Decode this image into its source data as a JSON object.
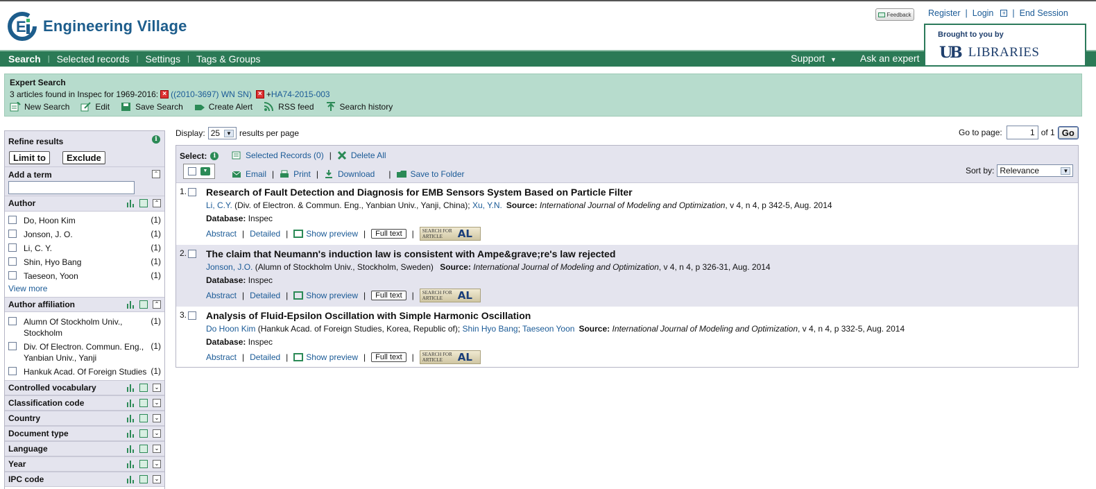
{
  "header": {
    "app_name": "Engineering Village",
    "feedback": "Feedback",
    "top_links": [
      "Register",
      "Login",
      "End Session"
    ],
    "brought_by": "Brought to you by",
    "library_name": "LIBRARIES",
    "library_mark": "UB"
  },
  "nav": {
    "items": [
      "Search",
      "Selected records",
      "Settings",
      "Tags & Groups"
    ],
    "support": "Support",
    "ask": "Ask an expert"
  },
  "summary": {
    "title": "Expert Search",
    "found_text": "3 articles found in Inspec for 1969-2016:",
    "term1": "((2010-3697) WN SN)",
    "term2_prefix": "+",
    "term2": "HA74-2015-003",
    "tools": [
      "New Search",
      "Edit",
      "Save Search",
      "Create Alert",
      "RSS feed",
      "Search history"
    ]
  },
  "sidebar": {
    "refine_title": "Refine results",
    "limit_btn": "Limit to",
    "exclude_btn": "Exclude",
    "add_term": "Add a term",
    "author_title": "Author",
    "authors": [
      {
        "name": "Do, Hoon Kim",
        "count": "(1)"
      },
      {
        "name": "Jonson, J. O.",
        "count": "(1)"
      },
      {
        "name": "Li, C. Y.",
        "count": "(1)"
      },
      {
        "name": "Shin, Hyo Bang",
        "count": "(1)"
      },
      {
        "name": "Taeseon, Yoon",
        "count": "(1)"
      }
    ],
    "view_more": "View more",
    "affil_title": "Author affiliation",
    "affiliations": [
      {
        "name": "Alumn Of Stockholm Univ., Stockholm",
        "count": "(1)"
      },
      {
        "name": "Div. Of Electron. Commun. Eng., Yanbian Univ., Yanji",
        "count": "(1)"
      },
      {
        "name": "Hankuk Acad. Of Foreign Studies",
        "count": "(1)"
      }
    ],
    "facets": [
      "Controlled vocabulary",
      "Classification code",
      "Country",
      "Document type",
      "Language",
      "Year",
      "IPC code"
    ]
  },
  "results": {
    "display_label": "Display:",
    "per_page": "25",
    "per_page_suffix": "results per page",
    "goto_label": "Go to page:",
    "page": "1",
    "of_pages": "of 1",
    "go": "Go",
    "select_label": "Select:",
    "selected_records": "Selected Records (0)",
    "delete_all": "Delete All",
    "email": "Email",
    "print": "Print",
    "download": "Download",
    "save_folder": "Save to Folder",
    "sort_label": "Sort by:",
    "sort_value": "Relevance",
    "links": {
      "abstract": "Abstract",
      "detailed": "Detailed",
      "preview": "Show preview",
      "fulltext": "Full text",
      "sfa_top": "SEARCH FOR",
      "sfa_bottom": "ARTICLE",
      "sfa_badge": "AL"
    },
    "database_label": "Database:",
    "source_label": "Source:",
    "records": [
      {
        "num": "1.",
        "title": "Research of Fault Detection and Diagnosis for EMB Sensors System Based on Particle Filter",
        "author1": "Li, C.Y.",
        "affil1": " (Div. of Electron. & Commun. Eng., Yanbian Univ., Yanji, China); ",
        "author2": "Xu, Y.N.",
        "author3": "",
        "journal": "International Journal of Modeling and Optimization",
        "citation": ", v 4, n 4, p 342-5, Aug. 2014",
        "database": "Inspec"
      },
      {
        "num": "2.",
        "title": "The claim that Neumann's induction law is consistent with Ampe&grave;re's law rejected",
        "author1": "Jonson, J.O.",
        "affil1": " (Alumn of Stockholm Univ., Stockholm, Sweden) ",
        "author2": "",
        "author3": "",
        "journal": "International Journal of Modeling and Optimization",
        "citation": ", v 4, n 4, p 326-31, Aug. 2014",
        "database": "Inspec"
      },
      {
        "num": "3.",
        "title": "Analysis of Fluid-Epsilon Oscillation with Simple Harmonic Oscillation",
        "author1": "Do Hoon Kim",
        "affil1": " (Hankuk Acad. of Foreign Studies, Korea, Republic of); ",
        "author2": "Shin Hyo Bang",
        "author3": "Taeseon Yoon",
        "journal": "International Journal of Modeling and Optimization",
        "citation": ", v 4, n 4, p 332-5, Aug. 2014",
        "database": "Inspec"
      }
    ]
  }
}
